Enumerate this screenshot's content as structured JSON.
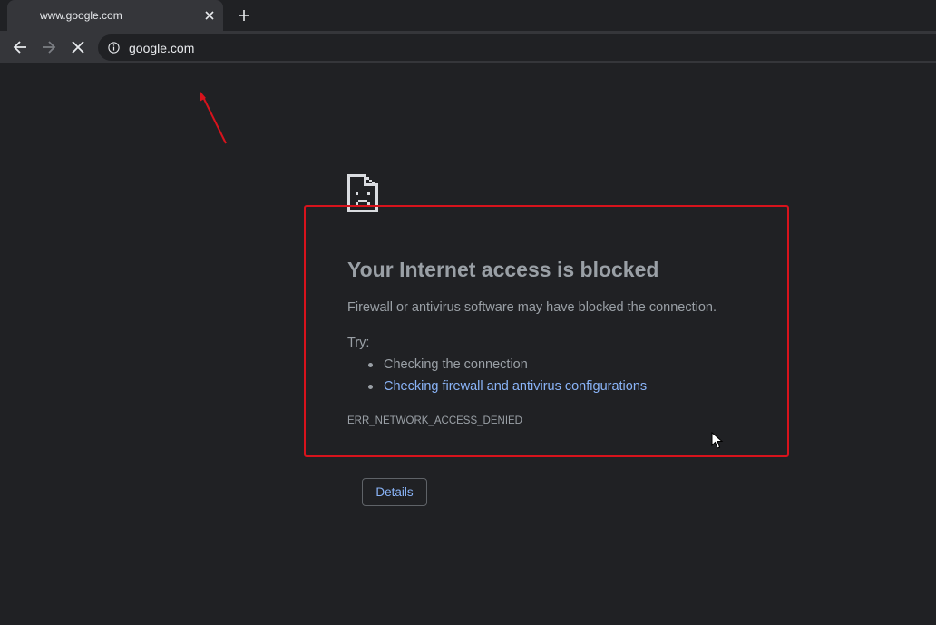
{
  "tab": {
    "title": "www.google.com",
    "close_icon": "close-icon",
    "new_tab_icon": "plus-icon"
  },
  "toolbar": {
    "back_icon": "arrow-left-icon",
    "forward_icon": "arrow-right-icon",
    "stop_icon": "close-icon",
    "site_info_icon": "info-icon",
    "url": "google.com"
  },
  "error": {
    "icon": "sad-page-icon",
    "title": "Your Internet access is blocked",
    "description": "Firewall or antivirus software may have blocked the connection.",
    "try_label": "Try:",
    "suggestions": [
      "Checking the connection",
      "Checking firewall and antivirus configurations"
    ],
    "code": "ERR_NETWORK_ACCESS_DENIED",
    "details_button": "Details"
  },
  "colors": {
    "page_bg": "#202124",
    "toolbar_bg": "#35363a",
    "text_muted": "#9aa0a6",
    "link": "#8ab4f8",
    "annotation_red": "#d7131c"
  }
}
